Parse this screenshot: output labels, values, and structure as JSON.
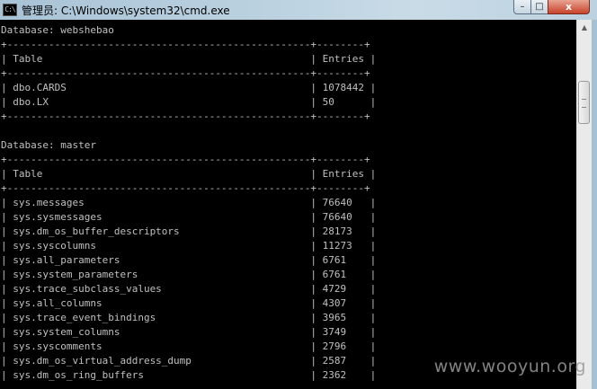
{
  "window": {
    "title": "管理员: C:\\Windows\\system32\\cmd.exe",
    "icon_label": "C:\\",
    "buttons": {
      "minimize": "–",
      "maximize": "□",
      "close": "x"
    }
  },
  "console": {
    "lines": [
      "Database: webshebao",
      "+---------------------------------------------------+--------+",
      "| Table                                             | Entries |",
      "+---------------------------------------------------+--------+",
      "| dbo.CARDS                                         | 1078442 |",
      "| dbo.LX                                            | 50      |",
      "+---------------------------------------------------+--------+",
      "",
      "Database: master",
      "+---------------------------------------------------+--------+",
      "| Table                                             | Entries |",
      "+---------------------------------------------------+--------+",
      "| sys.messages                                      | 76640   |",
      "| sys.sysmessages                                   | 76640   |",
      "| sys.dm_os_buffer_descriptors                      | 28173   |",
      "| sys.syscolumns                                    | 11273   |",
      "| sys.all_parameters                                | 6761    |",
      "| sys.system_parameters                             | 6761    |",
      "| sys.trace_subclass_values                         | 4729    |",
      "| sys.all_columns                                   | 4307    |",
      "| sys.trace_event_bindings                          | 3965    |",
      "| sys.system_columns                                | 3749    |",
      "| sys.syscomments                                   | 2796    |",
      "| sys.dm_os_virtual_address_dump                    | 2587    |",
      "| sys.dm_os_ring_buffers                            | 2362    |"
    ]
  },
  "scrollbar": {
    "up_arrow": "▲"
  },
  "watermark": "www.wooyun.org",
  "colors": {
    "console_bg": "#000000",
    "console_text": "#c0c0c0",
    "titlebar": "#b9d0df",
    "close_button": "#c7432a"
  }
}
